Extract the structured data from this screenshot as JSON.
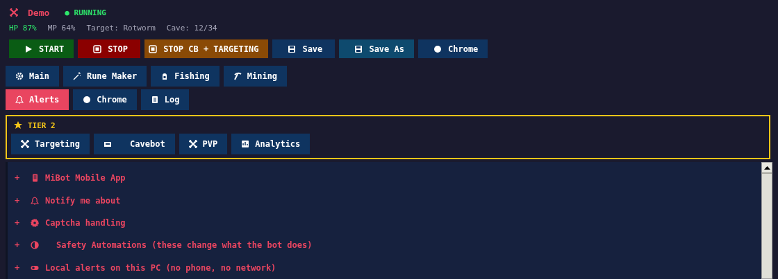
{
  "header": {
    "title": "Demo",
    "status": "● RUNNING"
  },
  "stats": [
    {
      "text": "HP 87%",
      "kind": "good"
    },
    {
      "text": "MP 64%",
      "kind": "plain"
    },
    {
      "text": "Target: Rotworm",
      "kind": "plain"
    },
    {
      "text": "Cave: 12/34",
      "kind": "plain"
    }
  ],
  "actions": [
    {
      "label": "START",
      "kind": "start"
    },
    {
      "label": "STOP",
      "kind": "stop"
    },
    {
      "label": "STOP CB + TARGETING",
      "kind": "warning"
    },
    {
      "label": "Save",
      "kind": "primary"
    },
    {
      "label": "Save As",
      "kind": "secondary"
    },
    {
      "label": "Chrome",
      "kind": "primary"
    }
  ],
  "tabs": [
    [
      {
        "label": "Main",
        "selected": false
      },
      {
        "label": "Rune Maker",
        "selected": false
      },
      {
        "label": "Fishing",
        "selected": false
      },
      {
        "label": "Mining",
        "selected": false
      }
    ],
    [
      {
        "label": "Alerts",
        "selected": true
      },
      {
        "label": "Chrome",
        "selected": false
      },
      {
        "label": "Log",
        "selected": false
      }
    ]
  ],
  "tier": {
    "title": "TIER 2",
    "tabs": [
      {
        "label": "Targeting",
        "selected": false
      },
      {
        "label": "Cavebot",
        "selected": false
      },
      {
        "label": "PVP",
        "selected": false
      },
      {
        "label": "Analytics",
        "selected": false
      }
    ]
  },
  "sections": [
    {
      "marker": "+",
      "title": "MiBot Mobile App"
    },
    {
      "marker": "+",
      "title": "Notify me about"
    },
    {
      "marker": "+",
      "title": "Captcha handling"
    },
    {
      "marker": "+",
      "title": "Safety Automations (these change what the bot does)"
    },
    {
      "marker": "+",
      "title": "Local alerts on this PC (no phone, no network)"
    }
  ]
}
